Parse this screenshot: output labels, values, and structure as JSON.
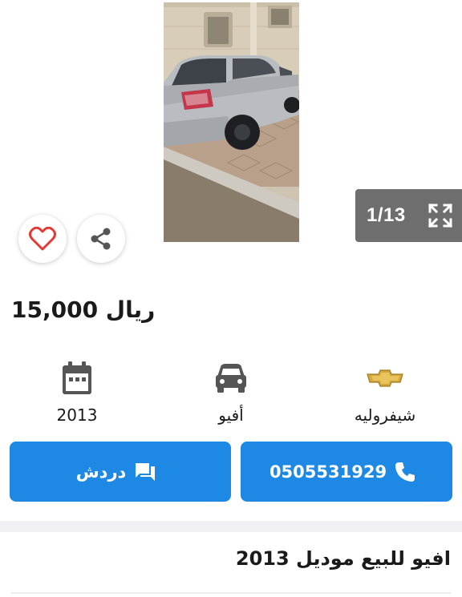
{
  "gallery": {
    "counter": "1/13",
    "photo_alt": "car-photo"
  },
  "listing": {
    "price": "15,000 ريال",
    "specs": {
      "year": "2013",
      "model": "أفيو",
      "make": "شيفروليه"
    },
    "title": "افيو للبيع موديل 2013"
  },
  "actions": {
    "chat_label": "دردش",
    "call_label": "0505531929"
  },
  "colors": {
    "primary": "#1e88e5",
    "favorite": "#e53935",
    "counter_bg": "#6e6e6e",
    "chevrolet_gold": "#d4a93c"
  },
  "icons": {
    "left": "chevron-left-icon",
    "right": "chevron-right-icon",
    "fullscreen": "fullscreen-icon",
    "favorite": "heart-icon",
    "share": "share-icon",
    "year": "calendar-icon",
    "model": "car-icon",
    "make": "chevrolet-logo-icon",
    "chat": "chat-icon",
    "call": "phone-icon"
  }
}
